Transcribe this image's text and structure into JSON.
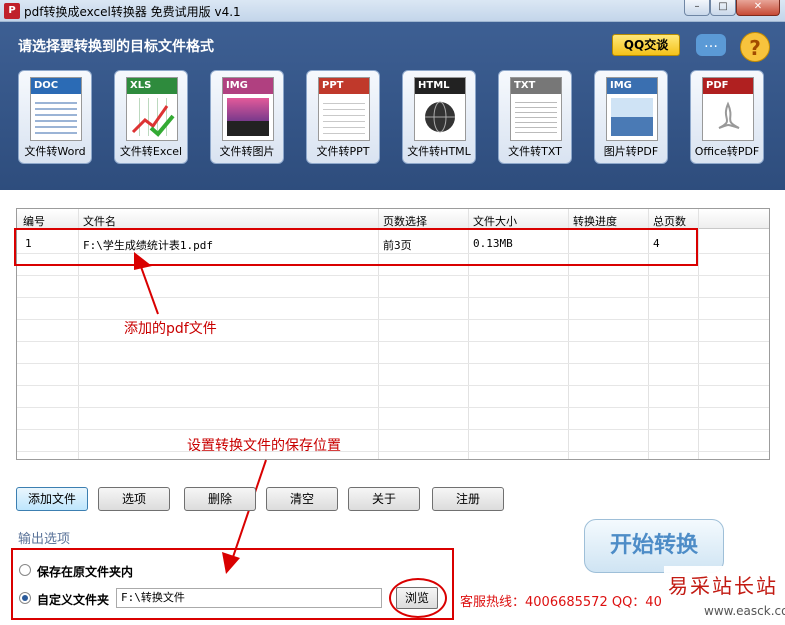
{
  "window": {
    "title": "pdf转换成excel转换器 免费试用版 v4.1"
  },
  "top": {
    "heading": "请选择要转换到的目标文件格式",
    "qq_label": "QQ交谈",
    "formats": [
      {
        "tag": "DOC",
        "label": "文件转Word",
        "color": "#2b6bb5"
      },
      {
        "tag": "XLS",
        "label": "文件转Excel",
        "color": "#2e8b3d"
      },
      {
        "tag": "IMG",
        "label": "文件转图片",
        "color": "#b04080"
      },
      {
        "tag": "PPT",
        "label": "文件转PPT",
        "color": "#c0392b"
      },
      {
        "tag": "HTML",
        "label": "文件转HTML",
        "color": "#222222"
      },
      {
        "tag": "TXT",
        "label": "文件转TXT",
        "color": "#777777"
      },
      {
        "tag": "IMG",
        "label": "图片转PDF",
        "color": "#3a6fb0"
      },
      {
        "tag": "PDF",
        "label": "Office转PDF",
        "color": "#b02020"
      }
    ]
  },
  "table": {
    "headers": [
      "编号",
      "文件名",
      "页数选择",
      "文件大小",
      "转换进度",
      "总页数"
    ],
    "rows": [
      [
        "1",
        "F:\\学生成绩统计表1.pdf",
        "前3页",
        "0.13MB",
        "",
        "4"
      ]
    ]
  },
  "annotations": {
    "added_pdf": "添加的pdf文件",
    "save_location": "设置转换文件的保存位置"
  },
  "buttons": {
    "add": "添加文件",
    "options": "选项",
    "delete": "删除",
    "clear": "清空",
    "about": "关于",
    "register": "注册"
  },
  "output": {
    "section": "输出选项",
    "keep_folder": "保存在原文件夹内",
    "custom_folder": "自定义文件夹",
    "path": "F:\\转换文件",
    "browse": "浏览",
    "start": "开始转换",
    "hotline": "客服热线：4006685572 QQ：40"
  },
  "watermark": {
    "line1": "易采站长站",
    "line2": "www.easck.com"
  }
}
